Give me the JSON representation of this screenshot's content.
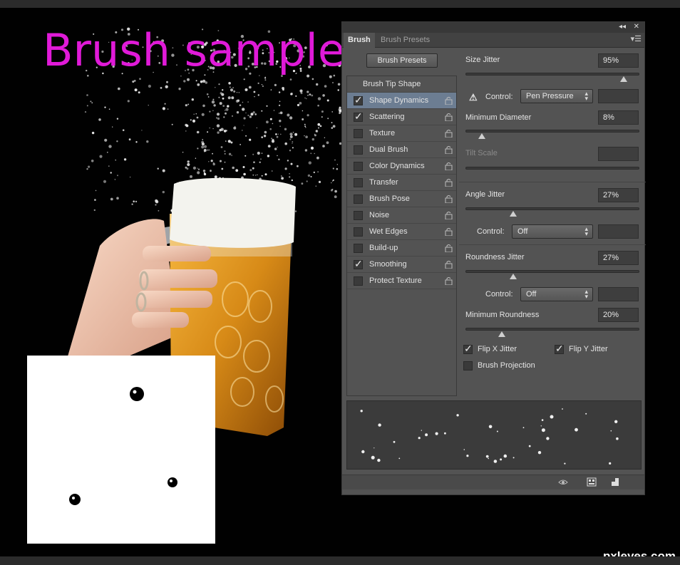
{
  "title": "Brush sample",
  "watermark": "pxleyes.com",
  "panel": {
    "tabs": [
      "Brush",
      "Brush Presets"
    ],
    "presets_button": "Brush Presets",
    "list": [
      {
        "label": "Brush Tip Shape",
        "checked": false,
        "header": true
      },
      {
        "label": "Shape Dynamics",
        "checked": true,
        "selected": true
      },
      {
        "label": "Scattering",
        "checked": true
      },
      {
        "label": "Texture",
        "checked": false
      },
      {
        "label": "Dual Brush",
        "checked": false
      },
      {
        "label": "Color Dynamics",
        "checked": false
      },
      {
        "label": "Transfer",
        "checked": false
      },
      {
        "label": "Brush Pose",
        "checked": false
      },
      {
        "label": "Noise",
        "checked": false
      },
      {
        "label": "Wet Edges",
        "checked": false
      },
      {
        "label": "Build-up",
        "checked": false
      },
      {
        "label": "Smoothing",
        "checked": true
      },
      {
        "label": "Protect Texture",
        "checked": false
      }
    ],
    "settings": {
      "size_jitter_label": "Size Jitter",
      "size_jitter_value": "95%",
      "size_jitter_level": 0.95,
      "control_label": "Control:",
      "control1_value": "Pen Pressure",
      "min_diameter_label": "Minimum Diameter",
      "min_diameter_value": "8%",
      "min_diameter_level": 0.08,
      "tilt_scale_label": "Tilt Scale",
      "angle_jitter_label": "Angle Jitter",
      "angle_jitter_value": "27%",
      "angle_jitter_level": 0.27,
      "control2_value": "Off",
      "roundness_jitter_label": "Roundness Jitter",
      "roundness_jitter_value": "27%",
      "roundness_jitter_level": 0.27,
      "control3_value": "Off",
      "min_roundness_label": "Minimum Roundness",
      "min_roundness_value": "20%",
      "min_roundness_level": 0.2,
      "flip_x_label": "Flip X Jitter",
      "flip_y_label": "Flip Y Jitter",
      "brush_projection_label": "Brush Projection"
    }
  }
}
